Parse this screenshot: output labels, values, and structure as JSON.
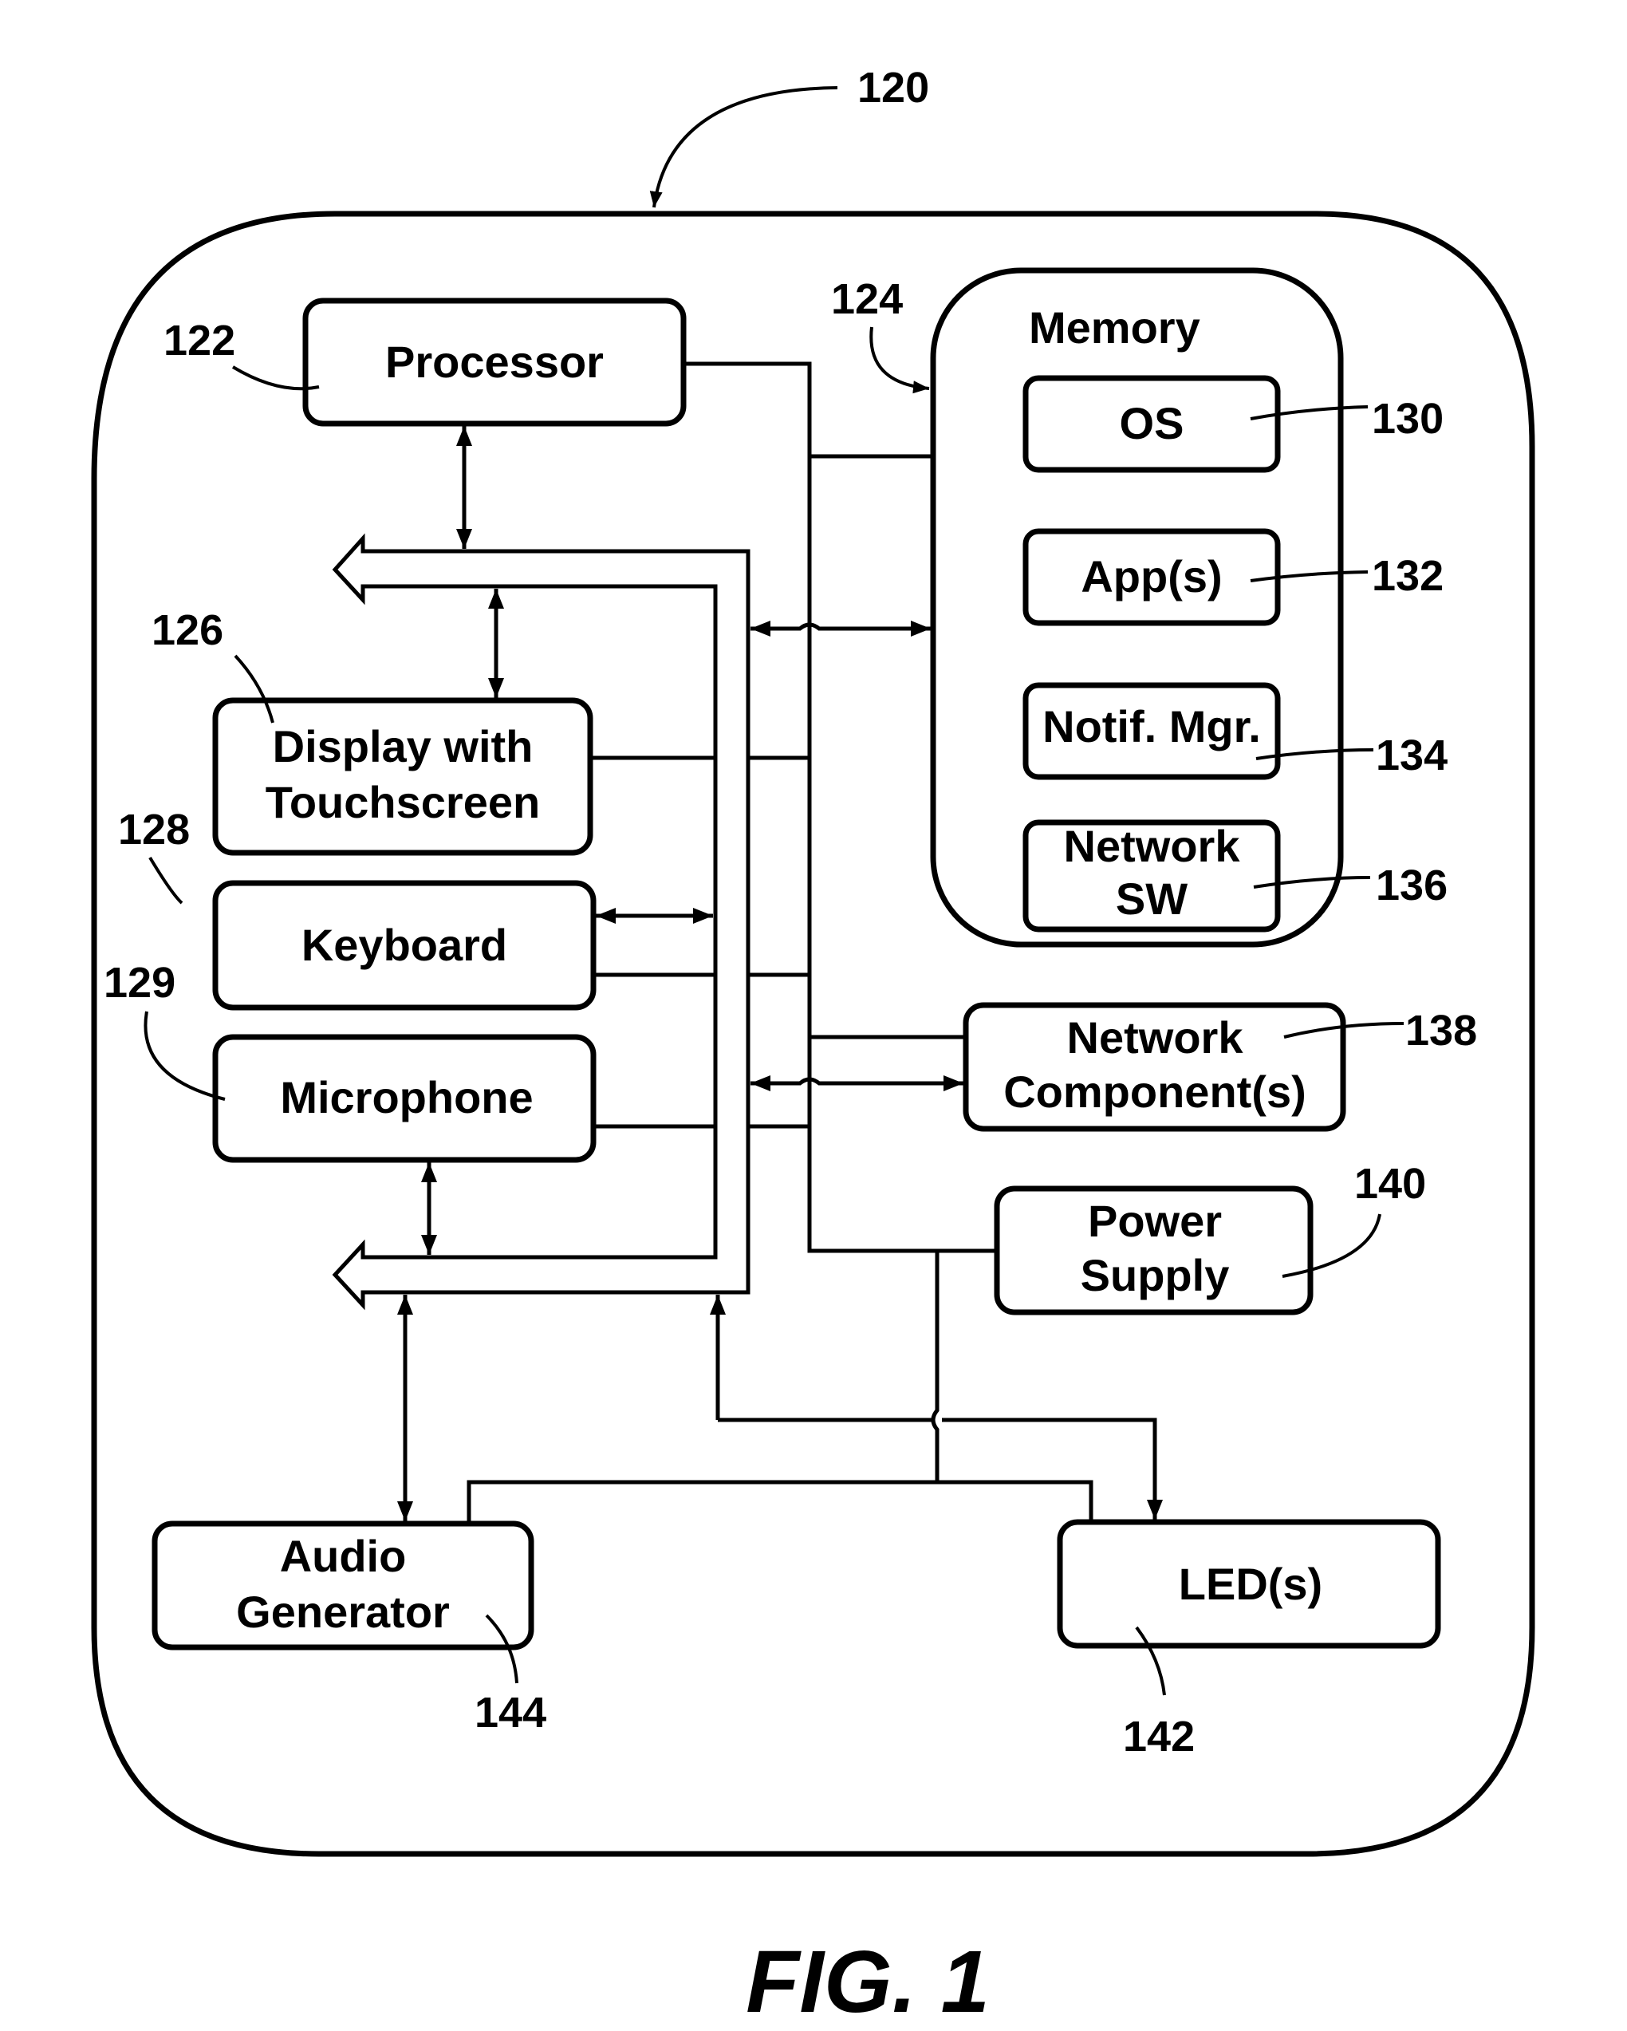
{
  "figure": {
    "caption": "FIG. 1",
    "device_ref": "120"
  },
  "components": {
    "processor": {
      "label": "Processor",
      "ref": "122"
    },
    "memory": {
      "label": "Memory",
      "ref": "124"
    },
    "display": {
      "label_lines": [
        "Display with",
        "Touchscreen"
      ],
      "ref": "126"
    },
    "keyboard": {
      "label": "Keyboard",
      "ref": "128"
    },
    "microphone": {
      "label": "Microphone",
      "ref": "129"
    },
    "os": {
      "label": "OS",
      "ref": "130"
    },
    "apps": {
      "label": "App(s)",
      "ref": "132"
    },
    "notif_mgr": {
      "label": "Notif. Mgr.",
      "ref": "134"
    },
    "network_sw": {
      "label_lines": [
        "Network",
        "SW"
      ],
      "ref": "136"
    },
    "network_component": {
      "label_lines": [
        "Network",
        "Component(s)"
      ],
      "ref": "138"
    },
    "power_supply": {
      "label_lines": [
        "Power",
        "Supply"
      ],
      "ref": "140"
    },
    "leds": {
      "label": "LED(s)",
      "ref": "142"
    },
    "audio_generator": {
      "label_lines": [
        "Audio",
        "Generator"
      ],
      "ref": "144"
    }
  }
}
